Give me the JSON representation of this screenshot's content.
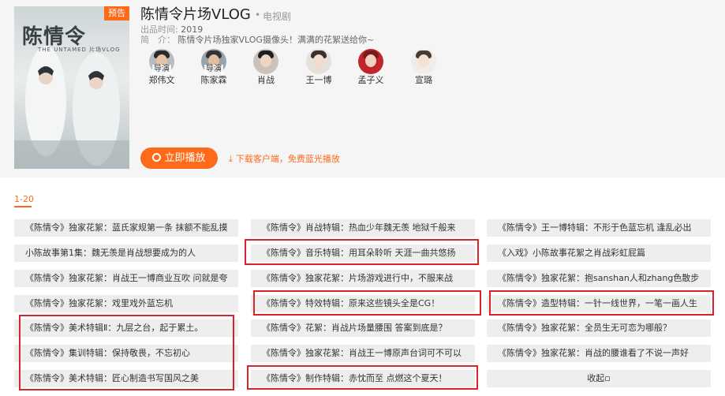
{
  "show": {
    "poster_tag": "预告",
    "poster_logo": "陈情令",
    "poster_sub": "THE UNTAMED 片场VLOG",
    "title": "陈情令片场VLOG",
    "dot": "•",
    "type": "电视剧",
    "year_label": "出品时间:",
    "year": "2019",
    "intro_label": "简　介：",
    "intro": "陈情令片场独家VLOG摄像头！满满的花絮送给你~"
  },
  "cast": [
    {
      "name": "郑伟文",
      "badge": "导演",
      "face": "#e6c2a4",
      "hair": "#2a2a2a",
      "bg": "#b6bcc0"
    },
    {
      "name": "陈家霖",
      "badge": "导演",
      "face": "#e2bea0",
      "hair": "#333333",
      "bg": "#9aa4a8"
    },
    {
      "name": "肖战",
      "badge": "",
      "face": "#f0d6c2",
      "hair": "#1e1e1e",
      "bg": "#c9c3bb"
    },
    {
      "name": "王一博",
      "badge": "",
      "face": "#f3dccb",
      "hair": "#3b3030",
      "bg": "#e4e0dc"
    },
    {
      "name": "孟子义",
      "badge": "",
      "face": "#f1d2c0",
      "hair": "#7a1b1b",
      "bg": "#c0262b"
    },
    {
      "name": "宣璐",
      "badge": "",
      "face": "#f5e0d2",
      "hair": "#4a3a34",
      "bg": "#f0ece8"
    }
  ],
  "actions": {
    "play": "立即播放",
    "download": "下载客户端，免费蓝光播放"
  },
  "episodes": {
    "range": "1-20",
    "items": [
      "《陈情令》独家花絮：蓝氏家规第一条 抹额不能乱摸",
      "《陈情令》肖战特辑：热血少年魏无羡 地狱千般来",
      "《陈情令》王一博特辑：不形于色蓝忘机 逢乱必出",
      "小陈故事第1集：魏无羡是肖战想要成为的人",
      "《陈情令》音乐特辑：用耳朵聆听 天涯一曲共悠扬",
      "《入戏》小陈故事花絮之肖战彩虹屁篇",
      "《陈情令》独家花絮：肖战王一博商业互吹 问就是夸",
      "《陈情令》独家花絮：片场游戏进行中，不服来战",
      "《陈情令》独家花絮：抱sanshan人和zhang色散步",
      "《陈情令》独家花絮：戏里戏外蓝忘机",
      "《陈情令》特效特辑：原来这些镜头全是CG！",
      "《陈情令》造型特辑：一针一线世界，一笔一画人生",
      "《陈情令》美术特辑Ⅱ：九层之台，起于累土。",
      "《陈情令》花絮：肖战片场量腰围 答案到底是？",
      "《陈情令》独家花絮：全员生无可恋为哪般？",
      "《陈情令》集训特辑：保持敬畏，不忘初心",
      "《陈情令》独家花絮：肖战王一博原声台词可不可以",
      "《陈情令》独家花絮：肖战的腰谁看了不说一声好",
      "《陈情令》美术特辑：匠心制造书写国风之美",
      "《陈情令》制作特辑：赤忱而至 点燃这个夏天！"
    ],
    "collapse": "收起▫"
  },
  "colors": {
    "accent": "#ff6a1a",
    "highlight": "#d9222a",
    "tile": "#eeeeee"
  }
}
